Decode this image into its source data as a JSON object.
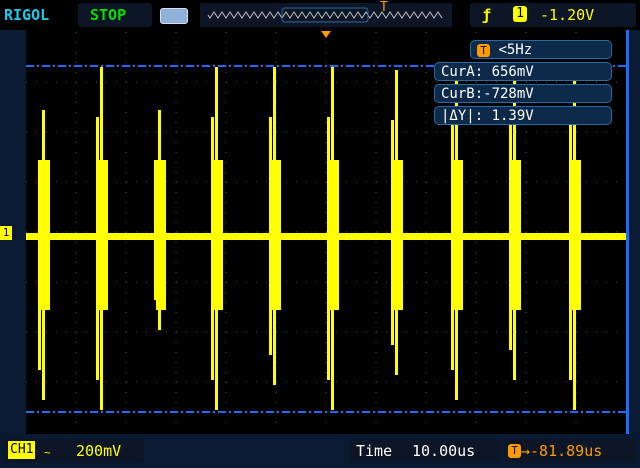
{
  "header": {
    "brand": "RIGOL",
    "run_state": "STOP",
    "trigger_slope_icon": "rising-edge-icon",
    "trigger_channel": "1",
    "trigger_level": "-1.20V",
    "trigger_marker": "T"
  },
  "measurements": {
    "trigger_freq": "<5Hz",
    "trigger_badge": "T",
    "cur_a": "CurA: 656mV",
    "cur_b": "CurB:-728mV",
    "delta_y": "|ΔY|: 1.39V"
  },
  "channel": {
    "marker": "1",
    "label": "CH1",
    "coupling_icon": "ac-coupling-icon",
    "scale": "200mV"
  },
  "timebase": {
    "label": "Time",
    "scale": "10.00us",
    "offset_badge": "T",
    "offset": "→-81.89us"
  },
  "colors": {
    "ch1": "#ffff00",
    "cursor": "#1e6bff",
    "run_state": "#00e000",
    "brand": "#20c8e8",
    "trigger": "#ff9a00"
  }
}
